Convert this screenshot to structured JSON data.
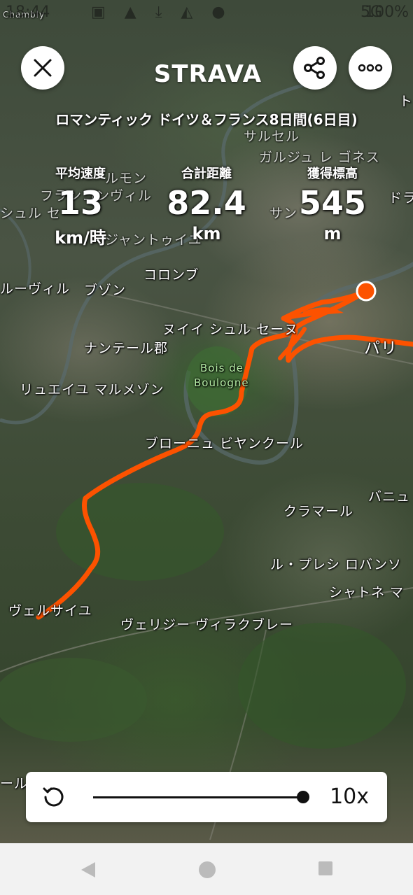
{
  "status_bar": {
    "time": "18:44",
    "network": "5G",
    "battery": "100%"
  },
  "header": {
    "logo": "STRAVA",
    "close_icon": "close-icon",
    "share_icon": "share-icon",
    "more_icon": "more-icon"
  },
  "activity": {
    "title": "ロマンティック ドイツ＆フランス8日間(6日目)",
    "stats": [
      {
        "label": "平均速度",
        "value": "13",
        "unit": "km/時"
      },
      {
        "label": "合計距離",
        "value": "82.4",
        "unit": "km"
      },
      {
        "label": "獲得標高",
        "value": "545",
        "unit": "m"
      }
    ]
  },
  "map_labels": {
    "chambly": "Chambly",
    "sarcelles": "サルセル",
    "garges": "ガルジュ レ ゴネス",
    "argenteuil_frag": "ルモン",
    "franconville": "フランコンヴィル",
    "seine": "シュル セー",
    "sartrouville": "ジャントゥイユ",
    "saint_denis": "サン",
    "colombes": "コロンブ",
    "houilles": "ルーヴィル",
    "bezons": "ブゾン",
    "neuilly": "ヌイイ シュル セーヌ",
    "nanterre": "ナンテール郡",
    "paris": "パリ",
    "bois1": "Bois de",
    "bois2": "Boulogne",
    "rueil": "リュエイユ マルメゾン",
    "boulogne": "ブローニュ ビヤンクール",
    "bagneux": "バニュ",
    "clamart": "クラマール",
    "plessis": "ル・プレシ ロバンソ",
    "chatenay": "シャトネ マ",
    "versailles": "ヴェルサイユ",
    "velizy": "ヴェリジー ヴィラクブレー",
    "left_edge": "ール",
    "right_frag": "ト",
    "right_frag2": "ドラ"
  },
  "player": {
    "speed": "10x",
    "progress": 1.0,
    "replay_icon": "replay-icon"
  },
  "nav": {
    "back_icon": "back-icon",
    "home_icon": "home-icon",
    "recents_icon": "recents-icon"
  },
  "colors": {
    "route": "#fc5200",
    "logo": "#ffffff",
    "button_bg": "#ffffff"
  }
}
